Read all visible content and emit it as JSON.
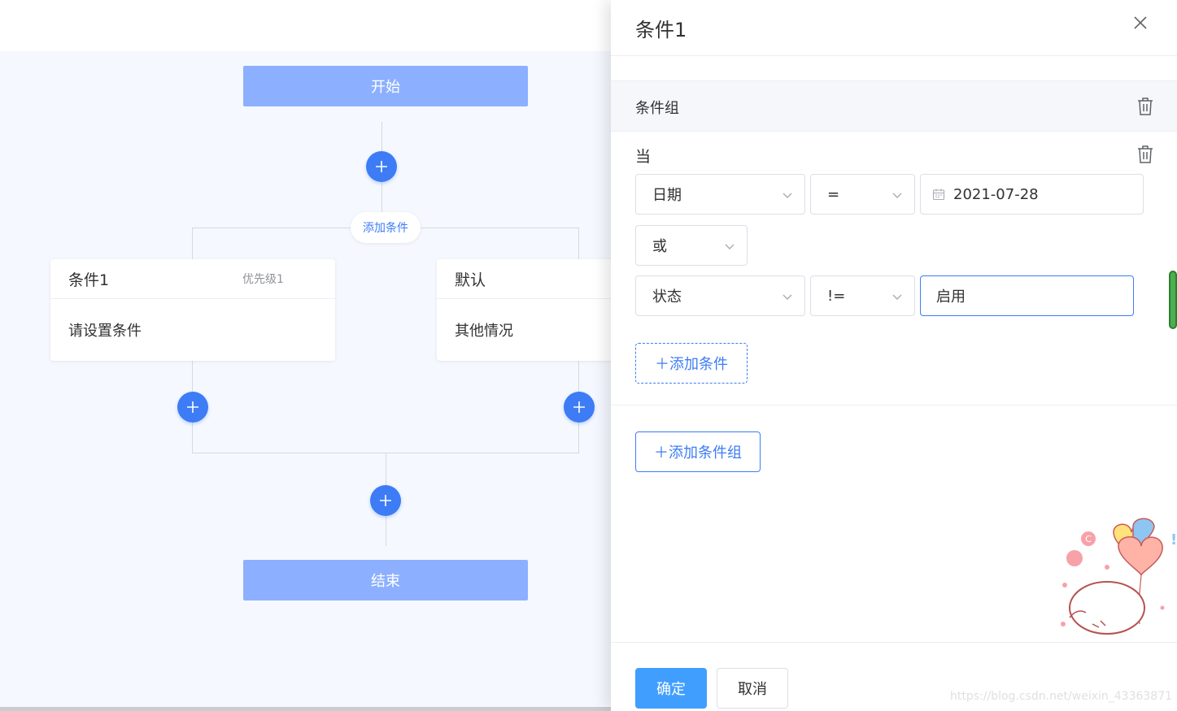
{
  "flow": {
    "start_label": "开始",
    "end_label": "结束",
    "add_condition_label": "添加条件",
    "branches": [
      {
        "title": "条件1",
        "priority": "优先级1",
        "content": "请设置条件"
      },
      {
        "title": "默认",
        "priority": "",
        "content": "其他情况"
      }
    ]
  },
  "drawer": {
    "title": "条件1",
    "group": {
      "title": "条件组",
      "when_label": "当",
      "rows": [
        {
          "field": "日期",
          "operator": "=",
          "value": "2021-07-28"
        },
        {
          "logic": "或"
        },
        {
          "field": "状态",
          "operator": "!=",
          "value": "启用"
        }
      ],
      "add_condition_label": "＋添加条件"
    },
    "add_group_label": "＋添加条件组",
    "confirm_label": "确定",
    "cancel_label": "取消"
  },
  "watermark": "https://blog.csdn.net/weixin_43363871",
  "colors": {
    "primary": "#3d7cf4",
    "node": "#8cb0ff",
    "confirm": "#409eff",
    "canvas_bg": "#f5f8ff"
  }
}
